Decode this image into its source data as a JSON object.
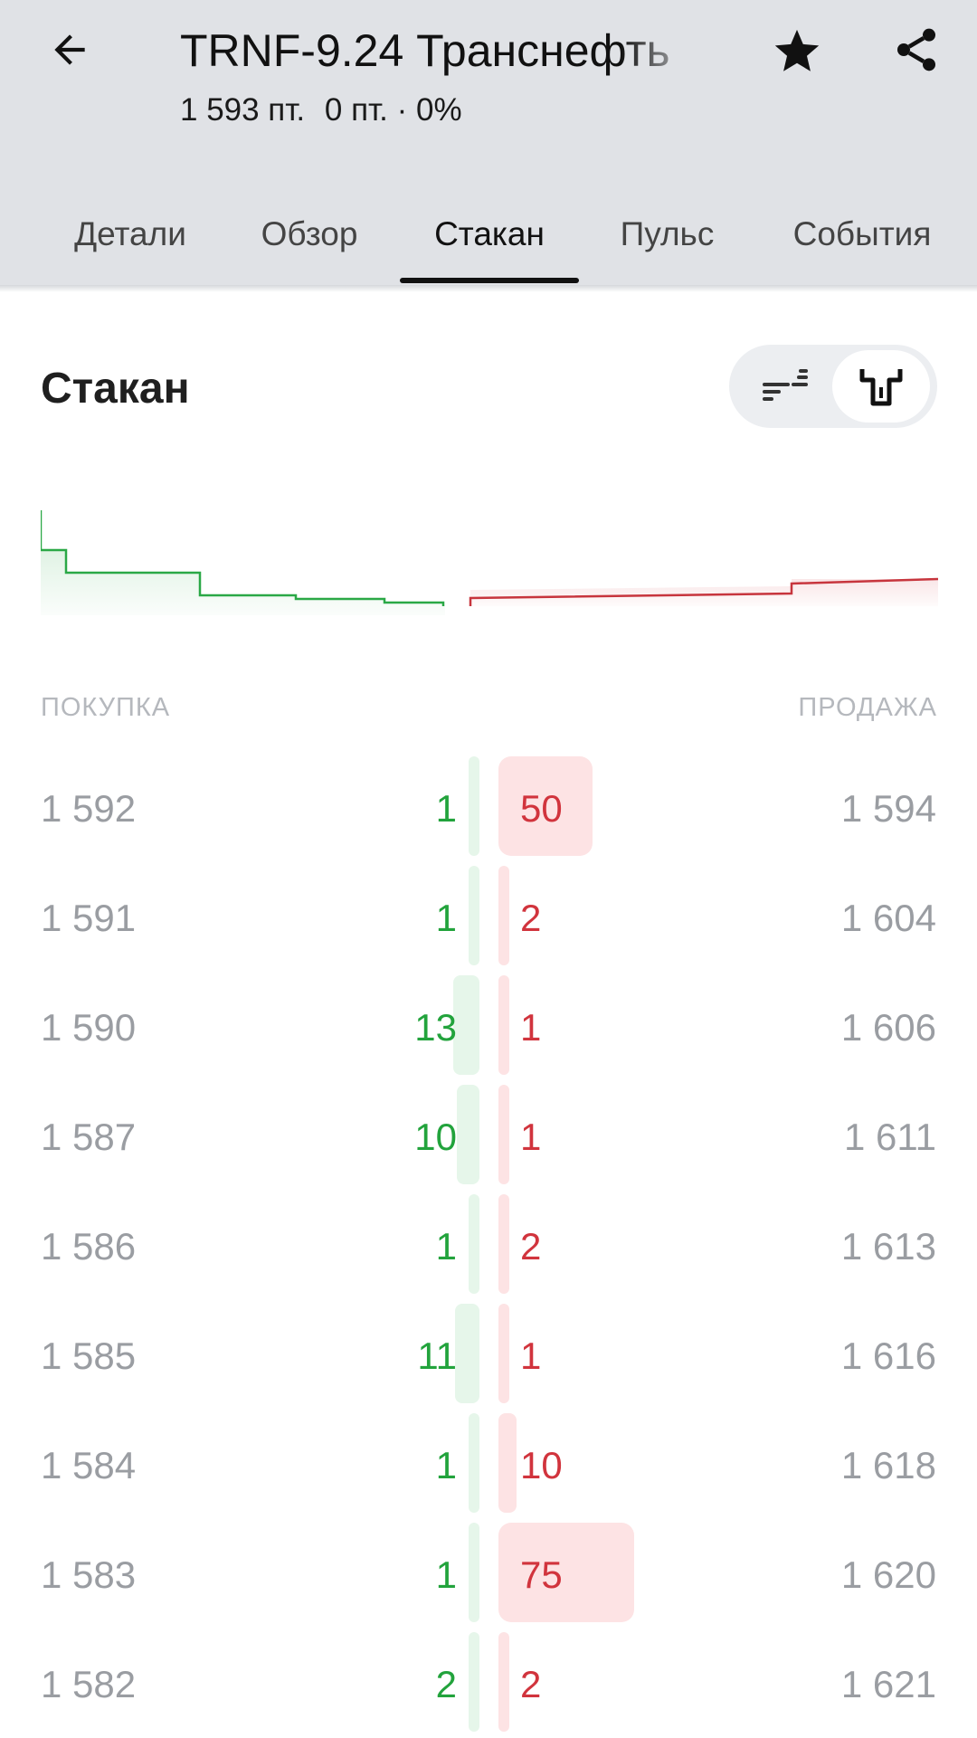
{
  "header": {
    "title": "TRNF-9.24 Транснефть",
    "price": "1 593 пт.",
    "change": "0 пт. · 0%"
  },
  "tabs": [
    {
      "label": "Детали"
    },
    {
      "label": "Обзор"
    },
    {
      "label": "Стакан",
      "active": true
    },
    {
      "label": "Пульс"
    },
    {
      "label": "События"
    }
  ],
  "section": {
    "title": "Стакан"
  },
  "book": {
    "buy_label": "ПОКУПКА",
    "sell_label": "ПРОДАЖА",
    "max_qty": 75,
    "rows": [
      {
        "bid_price": "1 592",
        "bid_qty": "1",
        "ask_qty": "50",
        "ask_price": "1 594"
      },
      {
        "bid_price": "1 591",
        "bid_qty": "1",
        "ask_qty": "2",
        "ask_price": "1 604"
      },
      {
        "bid_price": "1 590",
        "bid_qty": "13",
        "ask_qty": "1",
        "ask_price": "1 606"
      },
      {
        "bid_price": "1 587",
        "bid_qty": "10",
        "ask_qty": "1",
        "ask_price": "1 611"
      },
      {
        "bid_price": "1 586",
        "bid_qty": "1",
        "ask_qty": "2",
        "ask_price": "1 613"
      },
      {
        "bid_price": "1 585",
        "bid_qty": "11",
        "ask_qty": "1",
        "ask_price": "1 616"
      },
      {
        "bid_price": "1 584",
        "bid_qty": "1",
        "ask_qty": "10",
        "ask_price": "1 618"
      },
      {
        "bid_price": "1 583",
        "bid_qty": "1",
        "ask_qty": "75",
        "ask_price": "1 620"
      },
      {
        "bid_price": "1 582",
        "bid_qty": "2",
        "ask_qty": "2",
        "ask_price": "1 621"
      }
    ]
  },
  "colors": {
    "bid": "#22a33c",
    "ask": "#d1343d",
    "bid_bar": "#e6f6ea",
    "ask_bar": "#fde3e4"
  },
  "icons": {
    "back": "arrow-left-icon",
    "favorite": "star-icon",
    "share": "share-icon",
    "list_view": "list-bars-icon",
    "depth_view": "depth-chart-icon"
  }
}
